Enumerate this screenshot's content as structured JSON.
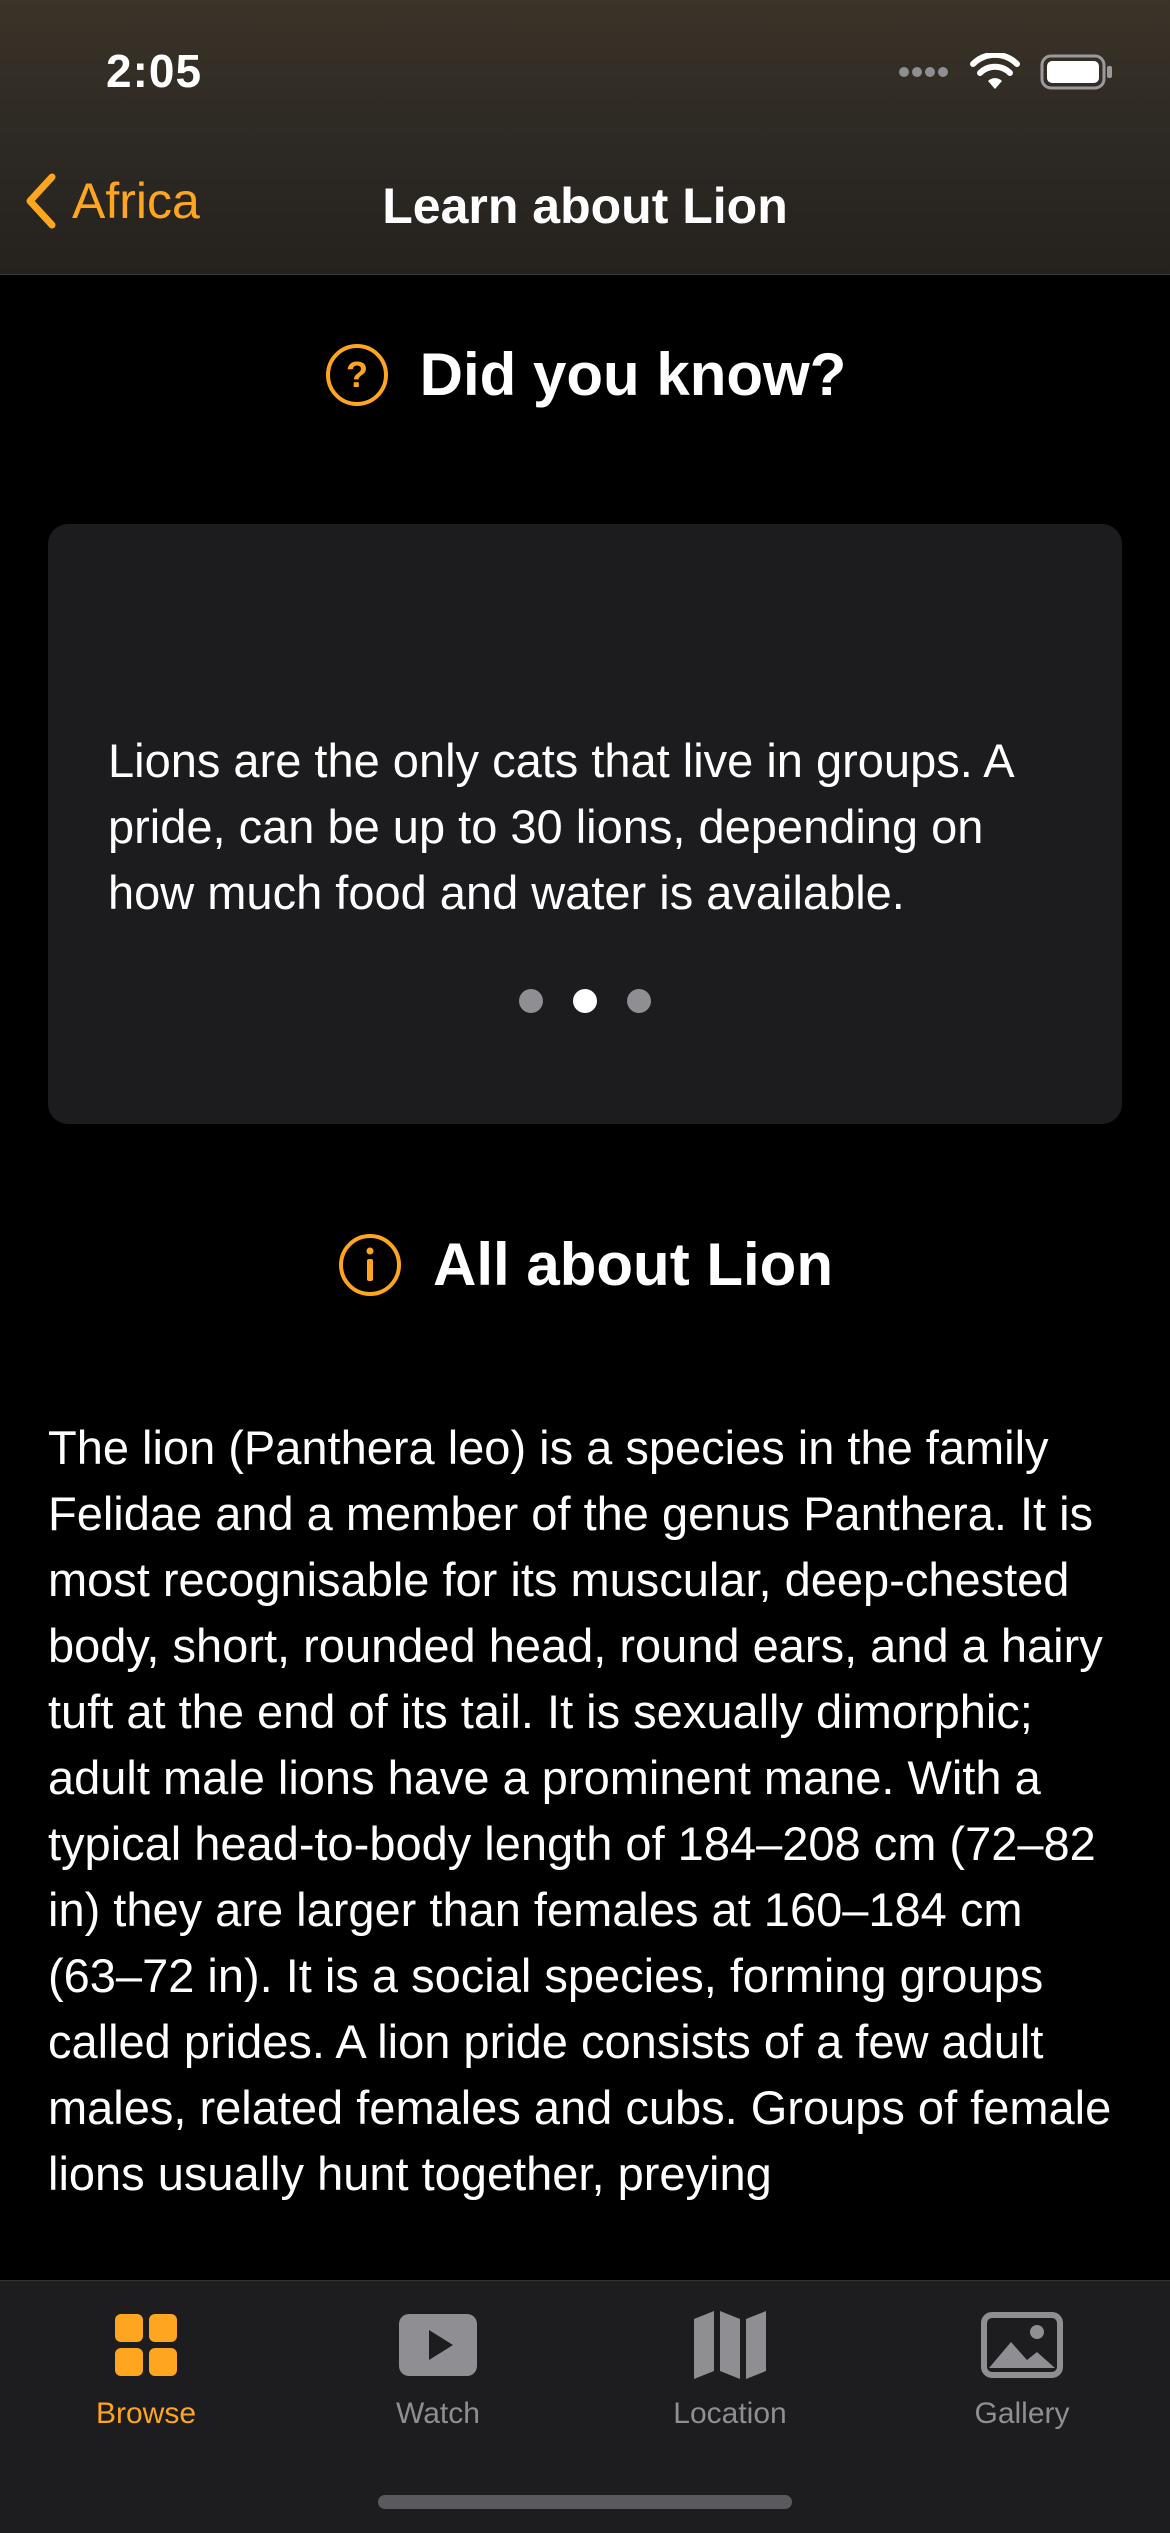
{
  "status_bar": {
    "time": "2:05"
  },
  "nav": {
    "back_label": "Africa",
    "title": "Learn about Lion"
  },
  "did_you_know": {
    "heading": "Did you know?",
    "fact": "Lions are the only cats that live in groups. A pride, can be up to 30 lions, depending on how much food and water is available.",
    "page_count": 3,
    "current_page": 2
  },
  "about": {
    "heading": "All about Lion",
    "body": "The lion (Panthera leo) is a species in the family Felidae and a member of the genus Panthera. It is most recognisable for its muscular, deep-chested body, short, rounded head, round ears, and a hairy tuft at the end of its tail. It is sexually dimorphic; adult male lions have a prominent mane. With a typical head-to-body length of 184–208 cm (72–82 in) they are larger than females at 160–184 cm (63–72 in). It is a social species, forming groups called prides. A lion pride consists of a few adult males, related females and cubs. Groups of female lions usually hunt together, preying"
  },
  "tabs": [
    {
      "label": "Browse",
      "icon": "grid-icon",
      "active": true
    },
    {
      "label": "Watch",
      "icon": "play-icon",
      "active": false
    },
    {
      "label": "Location",
      "icon": "map-icon",
      "active": false
    },
    {
      "label": "Gallery",
      "icon": "photo-icon",
      "active": false
    }
  ],
  "colors": {
    "accent": "#FFA51F",
    "background": "#000000",
    "card": "#1C1C1E",
    "inactive": "#8E8E93"
  }
}
